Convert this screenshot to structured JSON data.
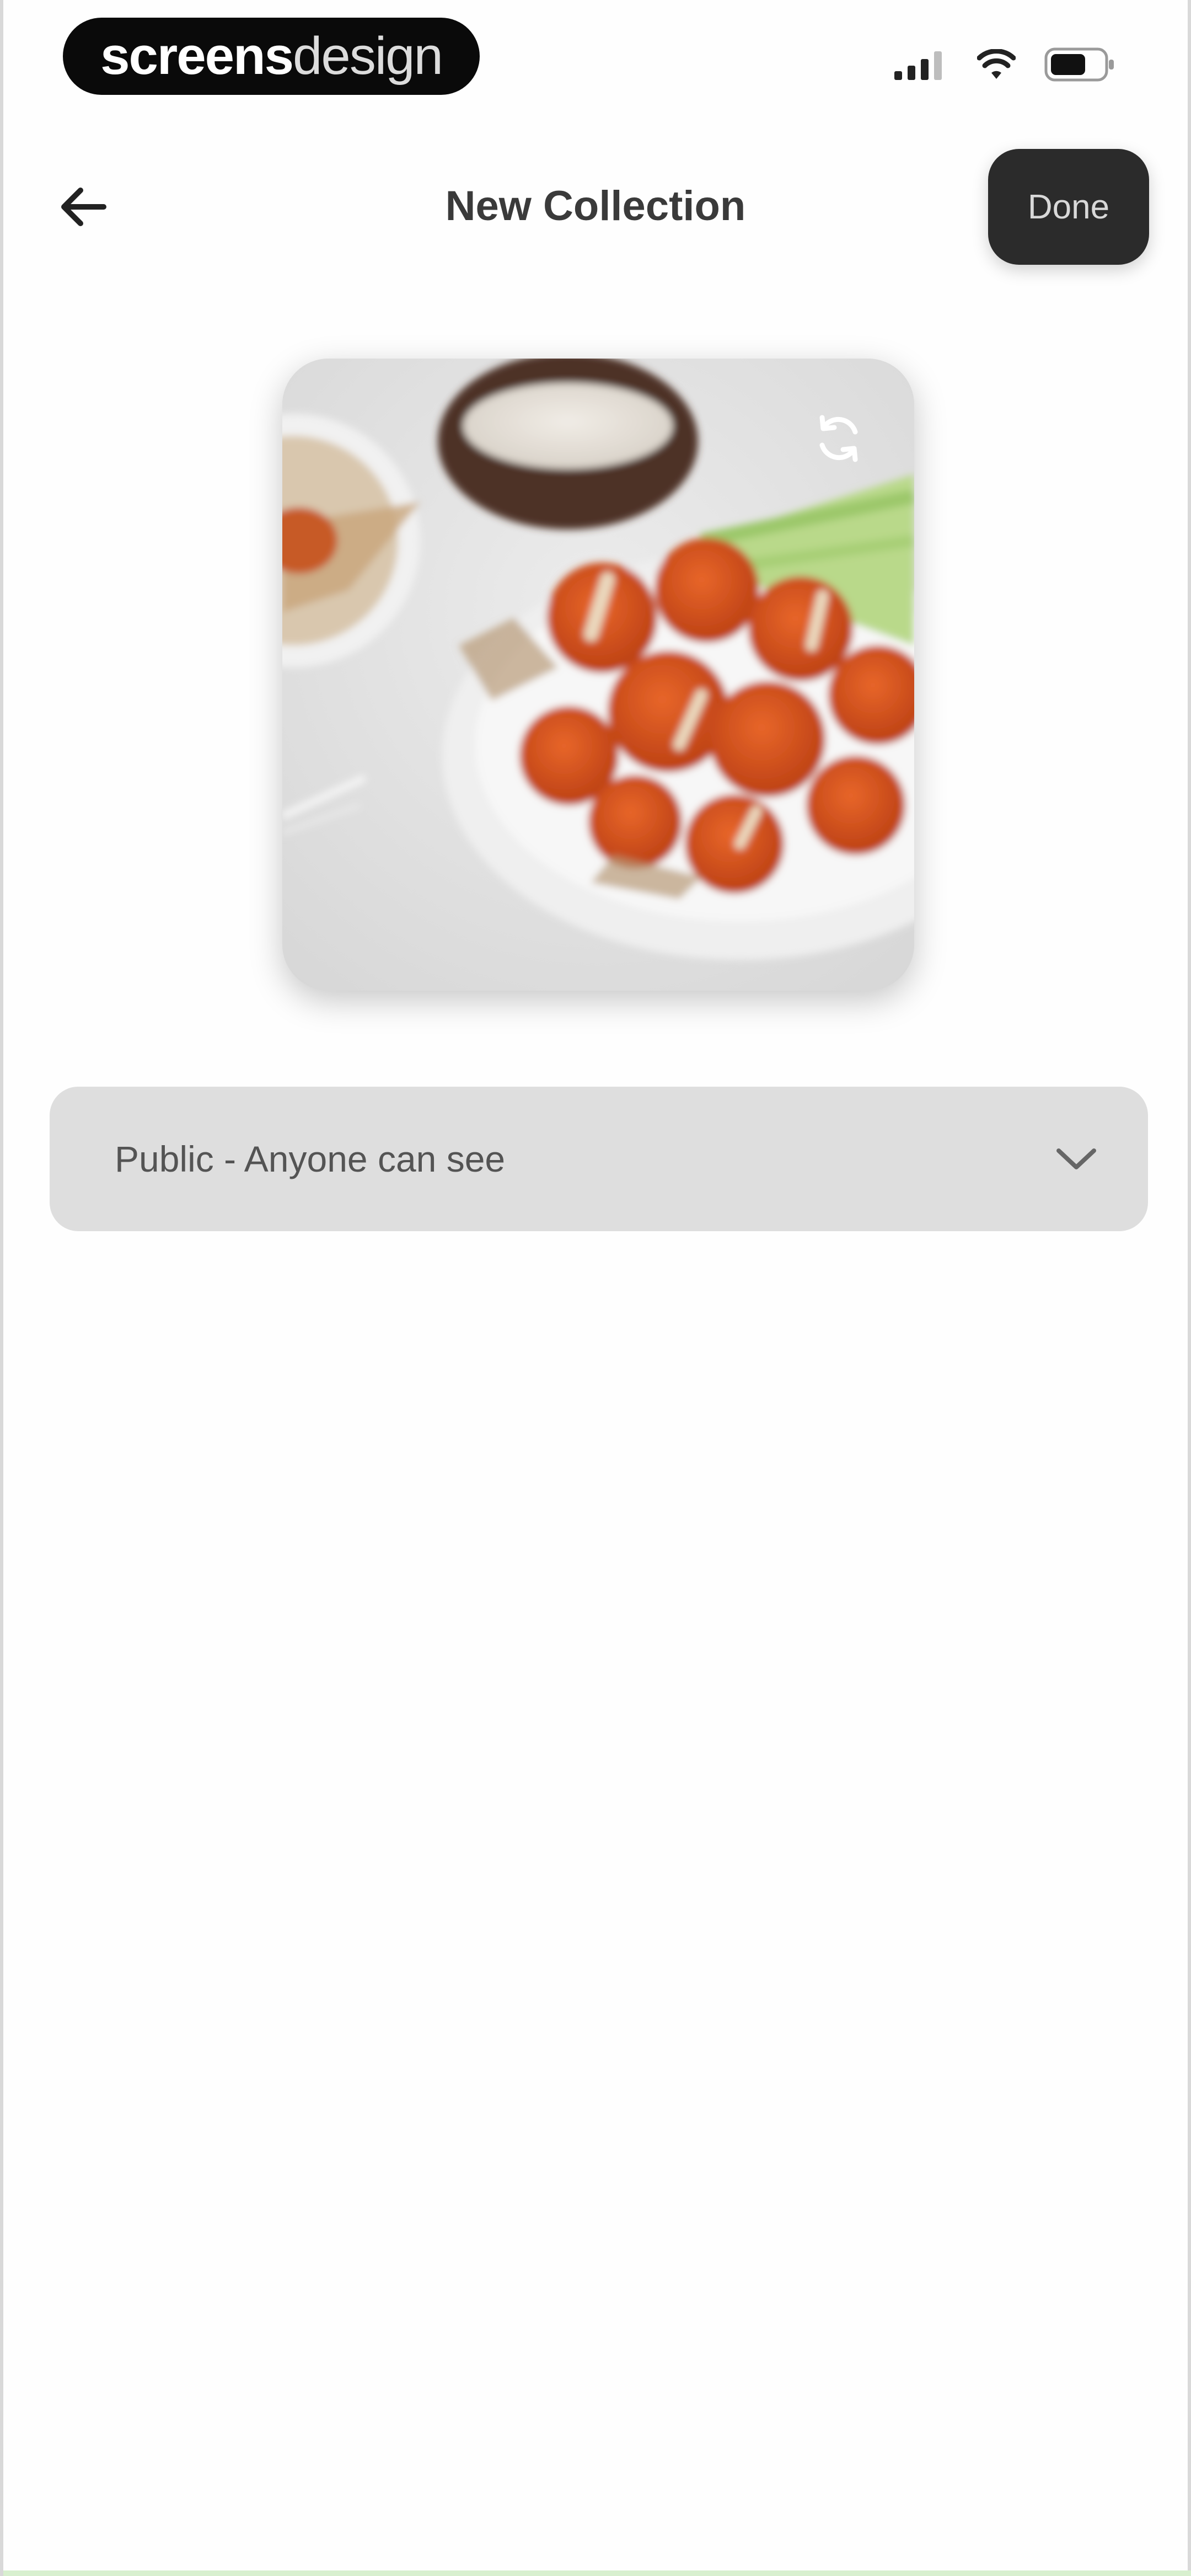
{
  "status_bar": {
    "brand_bold": "screens",
    "brand_light": "design"
  },
  "header": {
    "title": "New Collection",
    "done_label": "Done"
  },
  "cover_image": {
    "icons": [
      "refresh-icon"
    ]
  },
  "visibility": {
    "selected": "Public - Anyone can see"
  },
  "colors": {
    "done_button_bg": "#2b2b2b",
    "select_bg": "#dedede",
    "text_primary": "#3a3a3a"
  }
}
